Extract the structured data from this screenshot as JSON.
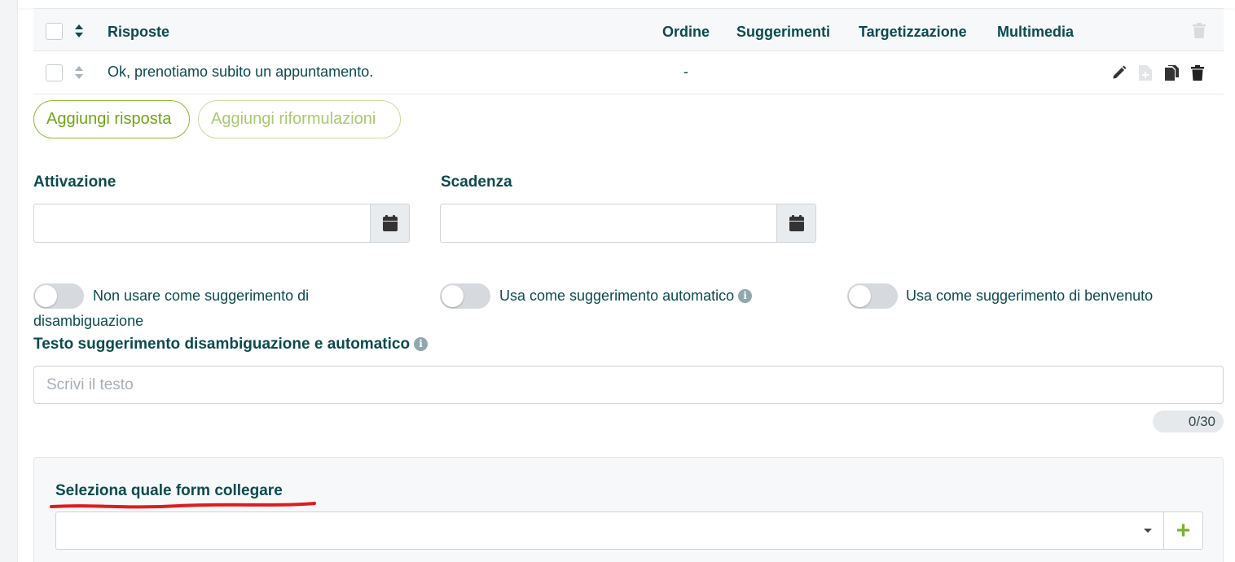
{
  "table": {
    "headers": {
      "risposte": "Risposte",
      "ordine": "Ordine",
      "suggerimenti": "Suggerimenti",
      "targetizzazione": "Targetizzazione",
      "multimedia": "Multimedia"
    },
    "rows": [
      {
        "text": "Ok, prenotiamo subito un appuntamento.",
        "ordine": "-"
      }
    ]
  },
  "buttons": {
    "add_response": "Aggiungi risposta",
    "add_reformulations": "Aggiungi riformulazioni"
  },
  "fields": {
    "activation_label": "Attivazione",
    "expiry_label": "Scadenza"
  },
  "toggles": {
    "disambiguation": {
      "label": "Non usare come suggerimento di disambiguazione",
      "on": false
    },
    "automatic": {
      "label": "Usa come suggerimento automatico",
      "on": false
    },
    "welcome": {
      "label": "Usa come suggerimento di benvenuto",
      "on": false
    }
  },
  "suggestion_text": {
    "label": "Testo suggerimento disambiguazione e automatico",
    "placeholder": "Scrivi il testo",
    "counter": "0/30"
  },
  "form_link": {
    "title": "Seleziona quale form collegare",
    "selected": "",
    "add_symbol": "+"
  },
  "icons": {
    "sort": "sort-icon",
    "edit": "pencil-icon",
    "add_file": "file-plus-icon",
    "copy": "copy-icon",
    "delete": "trash-icon",
    "calendar": "calendar-icon",
    "info": "info-icon",
    "dropdown": "caret-down-icon"
  },
  "colors": {
    "primary_text": "#0b4a4f",
    "accent_green": "#7db22a",
    "annotation_red": "#e01b1b"
  }
}
